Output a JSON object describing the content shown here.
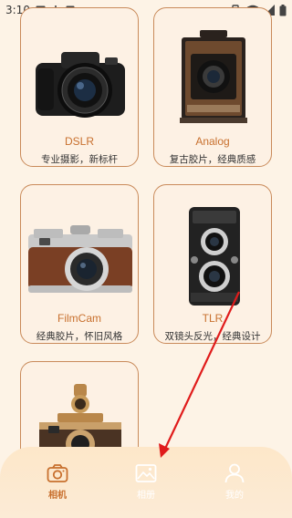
{
  "status_bar": {
    "time": "3:10"
  },
  "cameras": [
    {
      "title": "DSLR",
      "subtitle": "专业摄影，新标杆"
    },
    {
      "title": "Analog",
      "subtitle": "复古胶片，经典质感"
    },
    {
      "title": "FilmCam",
      "subtitle": "经典胶片，怀旧风格"
    },
    {
      "title": "TLR",
      "subtitle": "双镜头反光，经典设计"
    }
  ],
  "tabs": [
    {
      "label": "相机",
      "icon": "camera-icon",
      "active": true
    },
    {
      "label": "相册",
      "icon": "gallery-icon",
      "active": false
    },
    {
      "label": "我的",
      "icon": "profile-icon",
      "active": false
    }
  ],
  "colors": {
    "accent": "#c8702e",
    "background": "#fdf3e6",
    "card_border": "#c98a5a",
    "arrow": "#e01b1b"
  }
}
